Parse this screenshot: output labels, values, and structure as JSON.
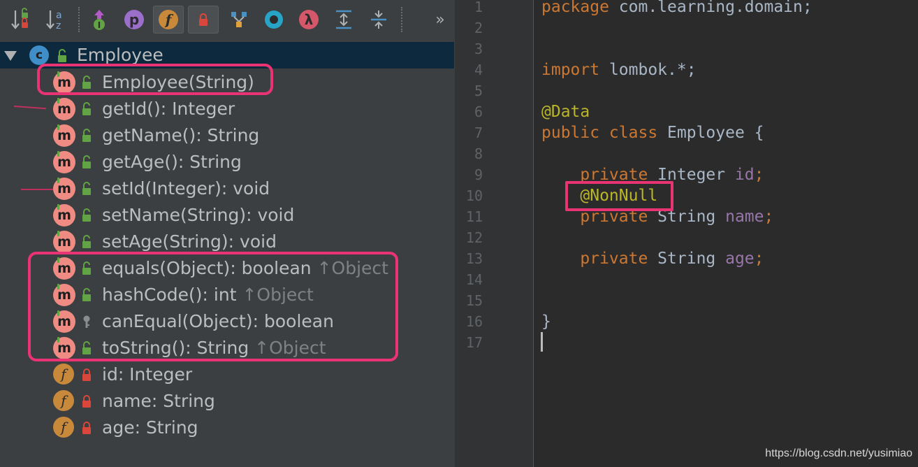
{
  "toolbar": {
    "buttons": [
      {
        "name": "sort-by-visibility-icon"
      },
      {
        "name": "sort-alphabetically-icon",
        "glyph_top": "a",
        "glyph_bottom": "z"
      },
      {
        "name": "show-inherited-icon",
        "glyph": "I"
      },
      {
        "name": "show-properties-icon",
        "glyph": "p"
      },
      {
        "name": "show-fields-icon",
        "glyph": "f"
      },
      {
        "name": "show-non-public-icon"
      },
      {
        "name": "show-hierarchy-icon"
      },
      {
        "name": "autoscroll-icon"
      },
      {
        "name": "show-lambdas-icon",
        "glyph": "λ"
      },
      {
        "name": "expand-all-icon"
      },
      {
        "name": "collapse-all-icon"
      }
    ],
    "more": "»"
  },
  "tree": {
    "root": {
      "icon": "c",
      "label": "Employee"
    },
    "members": [
      {
        "kind": "m",
        "label": "Employee(String)",
        "hint": ""
      },
      {
        "kind": "m",
        "label": "getId(): Integer",
        "hint": ""
      },
      {
        "kind": "m",
        "label": "getName(): String",
        "hint": ""
      },
      {
        "kind": "m",
        "label": "getAge(): String",
        "hint": ""
      },
      {
        "kind": "m",
        "label": "setId(Integer): void",
        "hint": ""
      },
      {
        "kind": "m",
        "label": "setName(String): void",
        "hint": ""
      },
      {
        "kind": "m",
        "label": "setAge(String): void",
        "hint": ""
      },
      {
        "kind": "m",
        "label": "equals(Object): boolean",
        "hint": "↑Object"
      },
      {
        "kind": "m",
        "label": "hashCode(): int",
        "hint": "↑Object"
      },
      {
        "kind": "m",
        "label": "canEqual(Object): boolean",
        "hint": ""
      },
      {
        "kind": "m",
        "label": "toString(): String",
        "hint": "↑Object"
      },
      {
        "kind": "f",
        "label": "id: Integer",
        "hint": ""
      },
      {
        "kind": "f",
        "label": "name: String",
        "hint": ""
      },
      {
        "kind": "f",
        "label": "age: String",
        "hint": ""
      }
    ]
  },
  "editor": {
    "line_numbers": [
      "1",
      "2",
      "3",
      "4",
      "5",
      "6",
      "7",
      "8",
      "9",
      "10",
      "11",
      "12",
      "13",
      "14",
      "15",
      "16",
      "17"
    ],
    "code": {
      "l1_kw": "package",
      "l1_rest": " com.learning.domain;",
      "l4_kw": "import",
      "l4_rest": " lombok.*;",
      "l6_ann": "@Data",
      "l7_kw": "public class",
      "l7_rest": " Employee {",
      "l9_kw": "private",
      "l9_type": " Integer ",
      "l9_field": "id",
      "l9_end": ";",
      "l10_ann": "@NonNull",
      "l11_kw": "private",
      "l11_type": " String ",
      "l11_field": "name",
      "l11_end": ";",
      "l13_kw": "private",
      "l13_type": " String ",
      "l13_field": "age",
      "l13_end": ";",
      "l16": "}"
    }
  },
  "watermark": "https://blog.csdn.net/yusimiao",
  "colors": {
    "highlight": "#ea3372",
    "method_icon": "#f08b84",
    "field_icon": "#c8893a",
    "keyword": "#cc7832",
    "annotation": "#bbb529",
    "field": "#9876aa"
  }
}
